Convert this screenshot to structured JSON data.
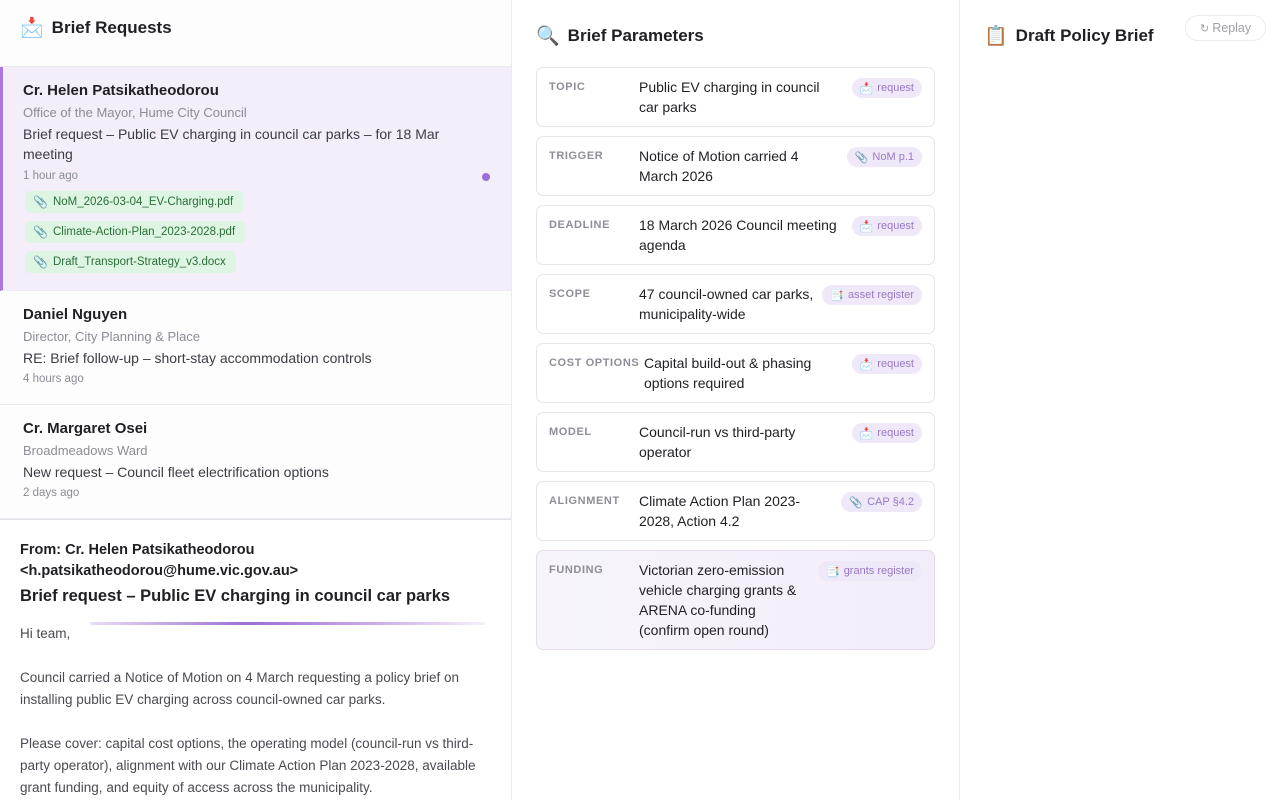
{
  "requests_panel": {
    "icon": "inbox-tray-icon",
    "icon_glyph": "📩",
    "title": "Brief Requests",
    "items": [
      {
        "name": "Cr. Helen Patsikatheodorou",
        "role": "Office of the Mayor, Hume City Council",
        "subject": "Brief request – Public EV charging in council car parks – for 18 Mar meeting",
        "time": "1 hour ago",
        "unread": true,
        "attachments": [
          "NoM_2026-03-04_EV-Charging.pdf",
          "Climate-Action-Plan_2023-2028.pdf",
          "Draft_Transport-Strategy_v3.docx"
        ]
      },
      {
        "name": "Daniel Nguyen",
        "role": "Director, City Planning & Place",
        "subject": "RE: Brief follow-up – short-stay accommodation controls",
        "time": "4 hours ago"
      },
      {
        "name": "Cr. Margaret Osei",
        "role": "Broadmeadows Ward",
        "subject": "New request – Council fleet electrification options",
        "time": "2 days ago"
      }
    ]
  },
  "email": {
    "from": "From: Cr. Helen Patsikatheodorou <h.patsikatheodorou@hume.vic.gov.au>",
    "subject": "Brief request – Public EV charging in council car parks",
    "body": [
      "Hi team,",
      "Council carried a Notice of Motion on 4 March requesting a policy brief on installing public EV charging across council-owned car parks.",
      "Please cover: capital cost options, the operating model (council-run vs third-party operator), alignment with our Climate Action Plan 2023-2028, available grant funding, and equity of access across the municipality."
    ]
  },
  "params_panel": {
    "icon": "magnifier-icon",
    "icon_glyph": "🔍",
    "title": "Brief Parameters",
    "rows": [
      {
        "key": "TOPIC",
        "value": "Public EV charging in council car parks",
        "tag": "request",
        "tag_icon": "envelope-icon",
        "tag_glyph": "📩"
      },
      {
        "key": "TRIGGER",
        "value": "Notice of Motion carried 4 March 2026",
        "tag": "NoM p.1",
        "tag_icon": "paperclip-icon",
        "tag_glyph": "📎"
      },
      {
        "key": "DEADLINE",
        "value": "18 March 2026 Council meeting agenda",
        "tag": "request",
        "tag_icon": "envelope-icon",
        "tag_glyph": "📩"
      },
      {
        "key": "SCOPE",
        "value": "47 council-owned car parks, municipality-wide",
        "tag": "asset register",
        "tag_icon": "document-icon",
        "tag_glyph": "📑"
      },
      {
        "key": "COST OPTIONS",
        "value": "Capital build-out & phasing options required",
        "tag": "request",
        "tag_icon": "envelope-icon",
        "tag_glyph": "📩"
      },
      {
        "key": "MODEL",
        "value": "Council-run vs third-party operator",
        "tag": "request",
        "tag_icon": "envelope-icon",
        "tag_glyph": "📩"
      },
      {
        "key": "ALIGNMENT",
        "value": "Climate Action Plan 2023-2028, Action 4.2",
        "tag": "CAP §4.2",
        "tag_icon": "paperclip-icon",
        "tag_glyph": "📎"
      },
      {
        "key": "FUNDING",
        "value": "Victorian zero-emission vehicle charging grants & ARENA co-funding (confirm open round)",
        "tag": "grants register",
        "tag_icon": "document-icon",
        "tag_glyph": "📑"
      }
    ]
  },
  "draft_panel": {
    "icon": "clipboard-icon",
    "icon_glyph": "📋",
    "title": "Draft Policy Brief",
    "replay_icon_glyph": "↻",
    "replay_label": "Replay"
  }
}
